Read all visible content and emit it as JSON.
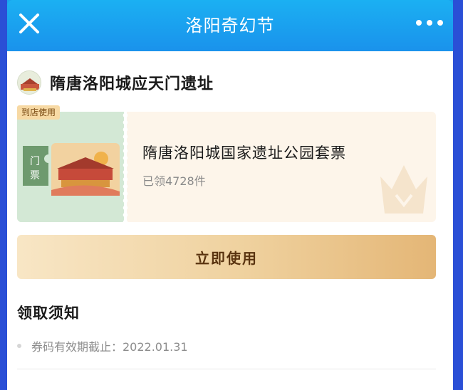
{
  "header": {
    "title": "洛阳奇幻节",
    "close_icon": "close-icon",
    "more_icon": "more-dots-icon"
  },
  "store": {
    "name": "隋唐洛阳城应天门遗址"
  },
  "ticket": {
    "tag": "到店使用",
    "stub_label": "门票",
    "title": "隋唐洛阳城国家遗址公园套票",
    "claimed": "已领4728件"
  },
  "actions": {
    "use_label": "立即使用"
  },
  "notice": {
    "title": "领取须知",
    "items": [
      "券码有效期截止：2022.01.31"
    ]
  },
  "colors": {
    "header_blue": "#1a92ec",
    "button_gold": "#efd19e",
    "ticket_green": "#d3e8d5",
    "ticket_cream": "#fdf5ea"
  }
}
